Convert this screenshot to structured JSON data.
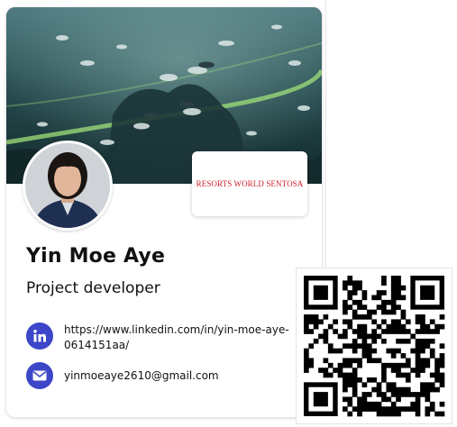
{
  "profile": {
    "name": "Yin Moe Aye",
    "role": "Project developer",
    "company_logo_text": "RESORTS WORLD SENTOSA"
  },
  "contacts": {
    "linkedin": {
      "icon": "linkedin-icon",
      "value": "https://www.linkedin.com/in/yin-moe-aye-0614151aa/"
    },
    "email": {
      "icon": "email-icon",
      "value": "yinmoeaye2610@gmail.com"
    }
  },
  "colors": {
    "icon_badge": "#3d46c8",
    "brand_red": "#d21f2a"
  }
}
